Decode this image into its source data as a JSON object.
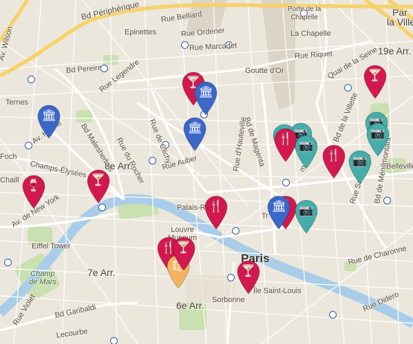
{
  "map": {
    "colors": {
      "restaurant": "#d3184f",
      "bar": "#d3184f",
      "museum": "#3a67c8",
      "photo": "#45aeab",
      "shop": "#f3b45d"
    },
    "labels": {
      "boulevard": "Bd Périphérique",
      "porte_chapelle": "Porte de la\nChapelle",
      "rue_belliard": "Rue Belliard",
      "av_wilson": "Av. Wilson",
      "epinettes": "Epinettes",
      "rue_ordener": "Rue Ordener",
      "la_chapelle": "La Chapelle",
      "rue_marcadet": "Rue Marcadet",
      "rue_riquet": "Rue Riquet",
      "nineteenth": "19e Arr.",
      "quai_seine": "Quai de la Seine",
      "bd_pereire": "Bd Pereire",
      "rue_legendre": "Rue Legendre",
      "goutte_or": "Goutte d'Or",
      "ternes": "Ternes",
      "bd_malesherbes": "Bd Malesherbes",
      "rue_de_clichy": "Rue de Clichy",
      "bd_de_magenta": "Bd de Magenta",
      "rue_du_rocher": "Rue du Rocher",
      "av_hoche": "Av. Hoche",
      "foch": "Foch",
      "champs": "Champs-Élysées",
      "eighth": "8e Arr.",
      "rue_auber": "Rue Auber",
      "rue_hauteville": "Rue d'Hauteville",
      "bd_villette": "Bd de la Villette",
      "belleville": "Belleville",
      "chaillot": "Chaill",
      "av_new_york": "Av. de New York",
      "palais_royal": "Palais-Ro",
      "rue_saint_maur": "Rue Saint-Maur",
      "bd_menilmontant": "Bd de Ménilmontant",
      "louvre": "Louvre\nMuseum",
      "eiffel": "Eiffel Tower",
      "paris": "Paris",
      "champ_de_mars": "Champ\nde Mars",
      "seventh": "7e Arr.",
      "rue_de_charonne": "Rue de Charonne",
      "sixth": "6e Arr.",
      "ile_st_louis": "Île Saint-Louis",
      "sorbonne": "Sorbonne",
      "bd_garibaldi": "Bd Garibaldi",
      "rue_violet": "Rue Violet",
      "lecourbe": "Lecourbe",
      "rue_didero": "Rue Didero",
      "frag_villette": "la Villette",
      "frag_par": "Par",
      "frag_tr": "Tr",
      "frag_may": "may"
    },
    "pins": [
      {
        "name": "bar-pin-1",
        "type": "bar",
        "glyph": "🍸"
      },
      {
        "name": "museum-pin-1",
        "type": "museum",
        "glyph": "🏛"
      },
      {
        "name": "museum-pin-2",
        "type": "museum",
        "glyph": "🏛"
      },
      {
        "name": "museum-pin-3",
        "type": "museum",
        "glyph": "🏛"
      },
      {
        "name": "bar-pin-2",
        "type": "bar",
        "glyph": "🍸"
      },
      {
        "name": "restaurant-pin-1",
        "type": "restaurant",
        "glyph": "🍷"
      },
      {
        "name": "bar-pin-3",
        "type": "bar",
        "glyph": "🍸"
      },
      {
        "name": "restaurant-pin-2",
        "type": "restaurant",
        "glyph": "🍴"
      },
      {
        "name": "photo-pin-1",
        "type": "photo",
        "glyph": "📷"
      },
      {
        "name": "photo-pin-2",
        "type": "photo",
        "glyph": "📷"
      },
      {
        "name": "restaurant-pin-3",
        "type": "restaurant",
        "glyph": "🍴"
      },
      {
        "name": "restaurant-pin-4",
        "type": "restaurant",
        "glyph": "🍴"
      },
      {
        "name": "photo-pin-3",
        "type": "photo",
        "glyph": "📷"
      },
      {
        "name": "photo-pin-4",
        "type": "photo",
        "glyph": "📷"
      },
      {
        "name": "photo-pin-5",
        "type": "photo",
        "glyph": "📷"
      },
      {
        "name": "photo-pin-6",
        "type": "photo",
        "glyph": "📷"
      },
      {
        "name": "restaurant-pin-5",
        "type": "restaurant",
        "glyph": "🍴"
      },
      {
        "name": "museum-pin-4",
        "type": "museum",
        "glyph": "🏛"
      },
      {
        "name": "photo-pin-7",
        "type": "photo",
        "glyph": "📷"
      },
      {
        "name": "restaurant-pin-6",
        "type": "restaurant",
        "glyph": "🍴"
      },
      {
        "name": "bar-pin-4",
        "type": "bar",
        "glyph": "🍸"
      },
      {
        "name": "shop-pin-1",
        "type": "shop",
        "glyph": "🛍"
      },
      {
        "name": "bar-pin-5",
        "type": "bar",
        "glyph": "🍸"
      }
    ]
  }
}
